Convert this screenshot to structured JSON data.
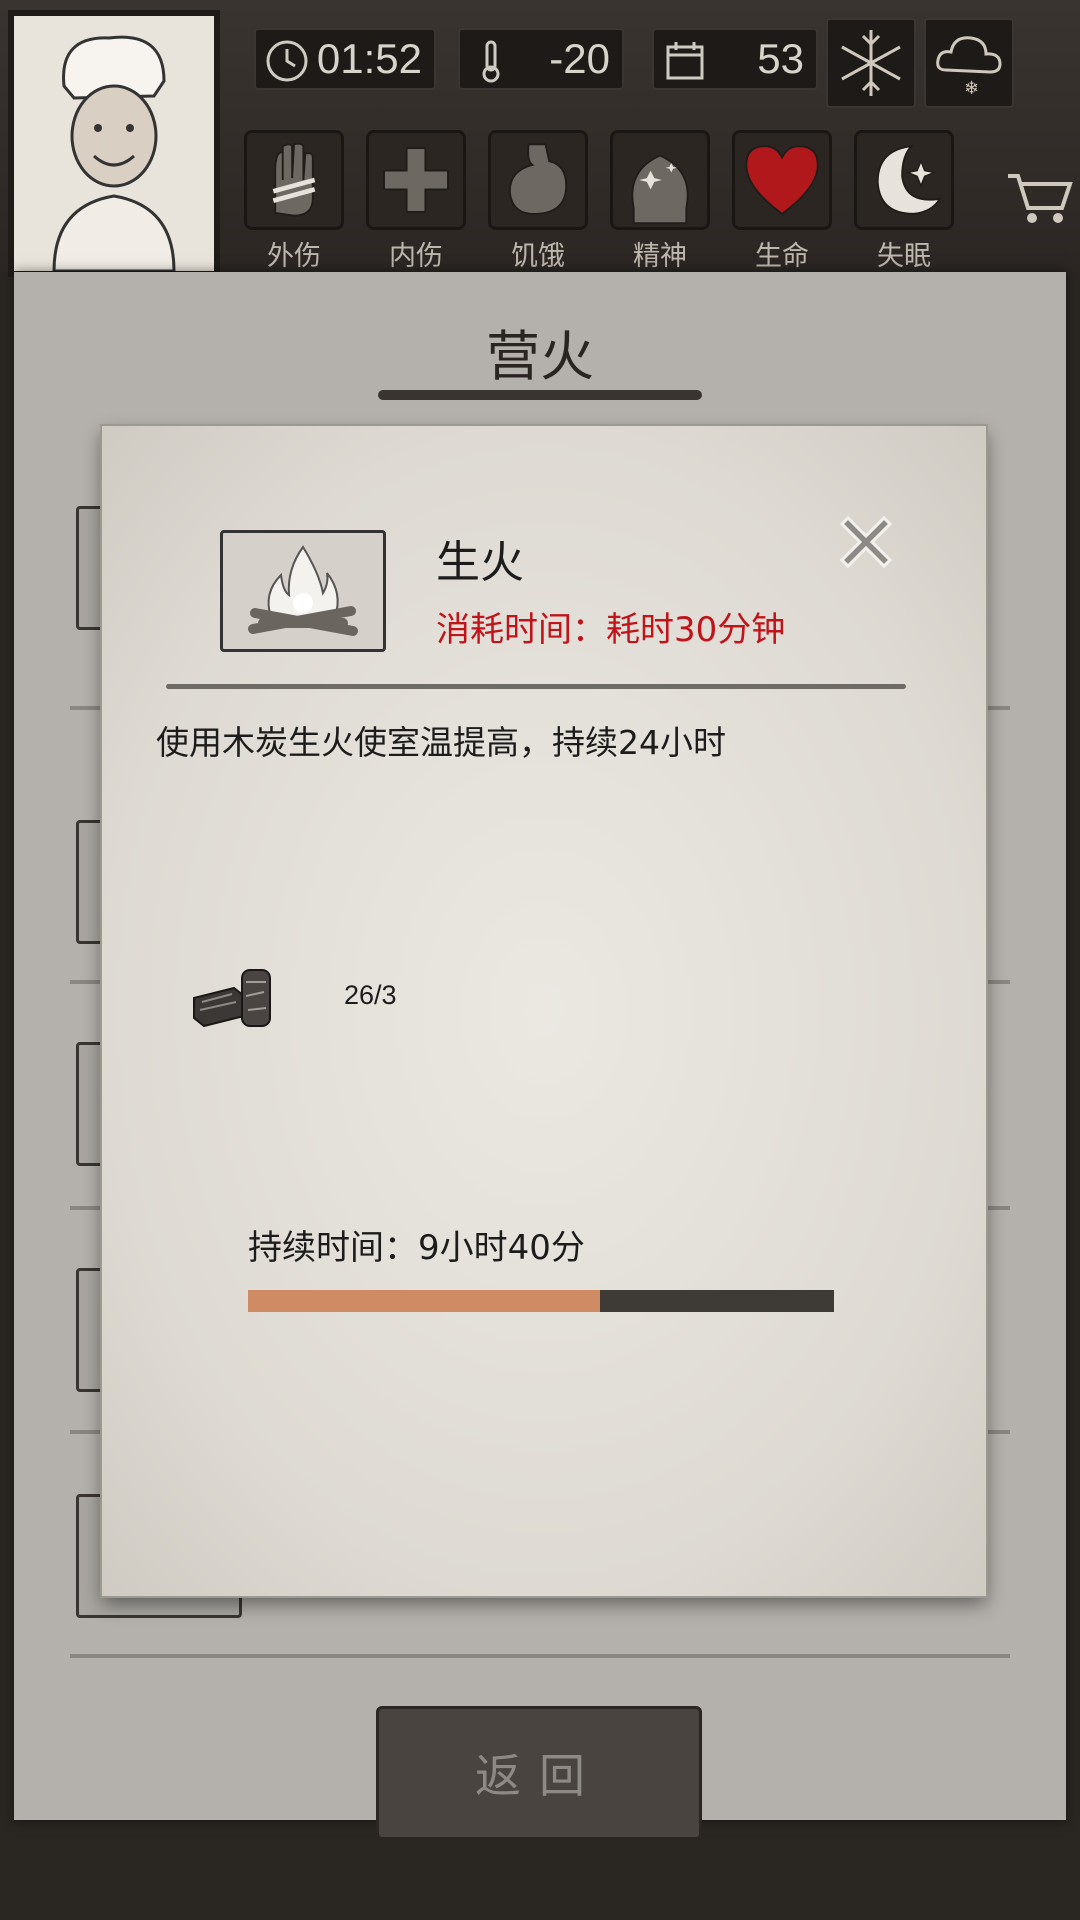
{
  "hud": {
    "time": "01:52",
    "temperature": "-20",
    "day": "53",
    "icons": [
      "clock-icon",
      "thermometer-icon",
      "calendar-icon",
      "snowflake-icon",
      "snow-cloud-icon"
    ]
  },
  "status_bar": [
    {
      "label": "外伤",
      "icon": "bandaged-hand-icon"
    },
    {
      "label": "内伤",
      "icon": "medical-cross-icon"
    },
    {
      "label": "饥饿",
      "icon": "stomach-icon"
    },
    {
      "label": "精神",
      "icon": "head-sparkle-icon"
    },
    {
      "label": "生命",
      "icon": "heart-icon"
    },
    {
      "label": "失眠",
      "icon": "moon-star-icon"
    }
  ],
  "colors": {
    "heart": "#b0181c",
    "cost_text": "#c0141a",
    "progress_fill": "#cf8b63",
    "progress_track": "#3e3a36"
  },
  "page": {
    "title": "营火",
    "back_button": "返回"
  },
  "modal": {
    "title": "生火",
    "cost": "消耗时间：耗时30分钟",
    "description": "使用木炭生火使室温提高，持续24小时",
    "material": {
      "icon": "charcoal-icon",
      "count": "26/3"
    },
    "duration_label": "持续时间：9小时40分",
    "progress": 0.6
  }
}
